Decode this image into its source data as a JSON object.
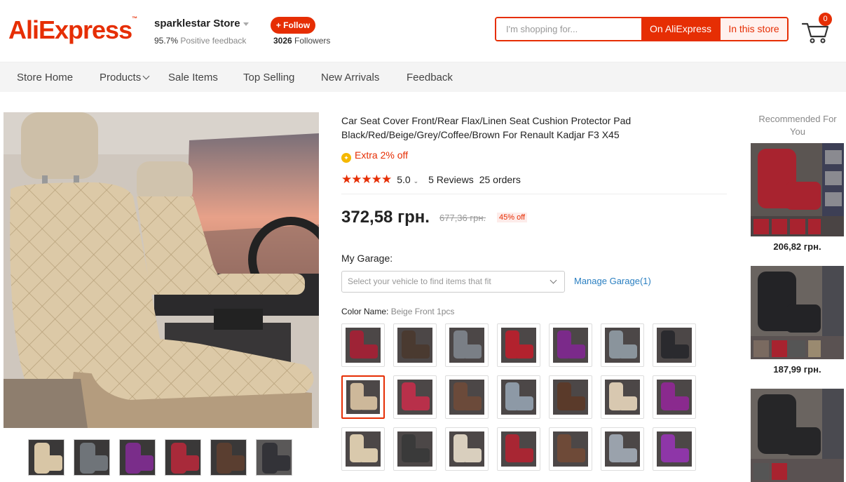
{
  "header": {
    "logo": "AliExpress",
    "store_name": "sparklestar Store",
    "feedback_pct": "95.7%",
    "feedback_label": "Positive feedback",
    "follow_label": "+ Follow",
    "followers_count": "3026",
    "followers_label": "Followers",
    "search_placeholder": "I'm shopping for...",
    "search_btn_ali": "On AliExpress",
    "search_btn_store": "In this store",
    "cart_count": "0"
  },
  "nav": {
    "items": [
      "Store Home",
      "Products",
      "Sale Items",
      "Top Selling",
      "New Arrivals",
      "Feedback"
    ]
  },
  "product": {
    "title": "Car Seat Cover Front/Rear Flax/Linen Seat Cushion Protector Pad Black/Red/Beige/Grey/Coffee/Brown For Renault Kadjar F3 X45",
    "extra": "Extra 2% off",
    "stars": "★★★★★",
    "rating": "5.0",
    "reviews": "5 Reviews",
    "orders": "25 orders",
    "price": "372,58 грн.",
    "old_price": "677,36 грн.",
    "discount": "45% off",
    "garage_label": "My Garage:",
    "garage_placeholder": "Select your vehicle to find items that fit",
    "manage_garage": "Manage Garage(1)",
    "color_label": "Color Name:",
    "color_value": "Beige Front 1pcs"
  },
  "colors": {
    "swatches": [
      "#9e2336",
      "#4a3a30",
      "#7a7f86",
      "#b2222e",
      "#7b2a8a",
      "#8a949c",
      "#2a2a2e",
      "#cdb89a",
      "#b8304a",
      "#6b4a3a",
      "#8d99a6",
      "#5a3a2a",
      "#d8c8b0",
      "#8a2a8e",
      "#d9c9ac",
      "#3a3a3a",
      "#d9cfbe",
      "#a82633",
      "#6e4a38",
      "#9aa2ac",
      "#8e36a8"
    ],
    "main_seat": "#dcc9a7",
    "accent": "#e62e04"
  },
  "gallery": {
    "thumbs": [
      "#d8c6a6",
      "#6f7479",
      "#7a2d8a",
      "#a82a3a",
      "#5a3e30",
      "#333338"
    ]
  },
  "recommend": {
    "title": "Recommended For You",
    "items": [
      {
        "price": "206,82 грн.",
        "color": "#a8232f"
      },
      {
        "price": "187,99 грн.",
        "color": "#232326"
      },
      {
        "price": "",
        "color": "#262628"
      }
    ]
  }
}
